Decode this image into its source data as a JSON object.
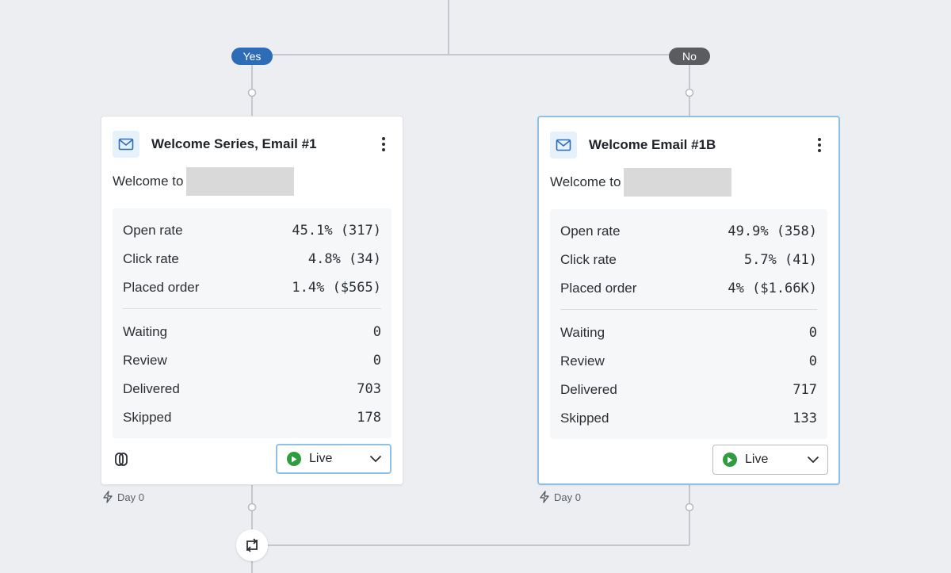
{
  "branches": {
    "yes_label": "Yes",
    "no_label": "No",
    "yes_color": "#2d6cb7",
    "no_color": "#5a5c60"
  },
  "cards": [
    {
      "title": "Welcome Series, Email #1",
      "subject_prefix": "Welcome to",
      "icon": "email-icon",
      "stats": {
        "open_rate": {
          "label": "Open rate",
          "value": "45.1% (317)"
        },
        "click_rate": {
          "label": "Click rate",
          "value": "4.8% (34)"
        },
        "placed_order": {
          "label": "Placed order",
          "value": "1.4% ($565)"
        },
        "waiting": {
          "label": "Waiting",
          "value": "0"
        },
        "review": {
          "label": "Review",
          "value": "0"
        },
        "delivered": {
          "label": "Delivered",
          "value": "703"
        },
        "skipped": {
          "label": "Skipped",
          "value": "178"
        }
      },
      "status": "Live",
      "status_color": "#2e9d3f",
      "day": "Day 0"
    },
    {
      "title": "Welcome Email #1B",
      "subject_prefix": "Welcome to",
      "icon": "email-icon",
      "stats": {
        "open_rate": {
          "label": "Open rate",
          "value": "49.9% (358)"
        },
        "click_rate": {
          "label": "Click rate",
          "value": "5.7% (41)"
        },
        "placed_order": {
          "label": "Placed order",
          "value": "4% ($1.66K)"
        },
        "waiting": {
          "label": "Waiting",
          "value": "0"
        },
        "review": {
          "label": "Review",
          "value": "0"
        },
        "delivered": {
          "label": "Delivered",
          "value": "717"
        },
        "skipped": {
          "label": "Skipped",
          "value": "133"
        }
      },
      "status": "Live",
      "status_color": "#2e9d3f",
      "day": "Day 0"
    }
  ],
  "icons": {
    "email": "email-icon",
    "kebab": "more-options-icon",
    "link": "link-icon",
    "play": "play-icon",
    "chevron": "chevron-down-icon",
    "bolt": "lightning-bolt-icon",
    "split": "split-merge-icon"
  },
  "accent_selected_border": "#8fc0e8"
}
